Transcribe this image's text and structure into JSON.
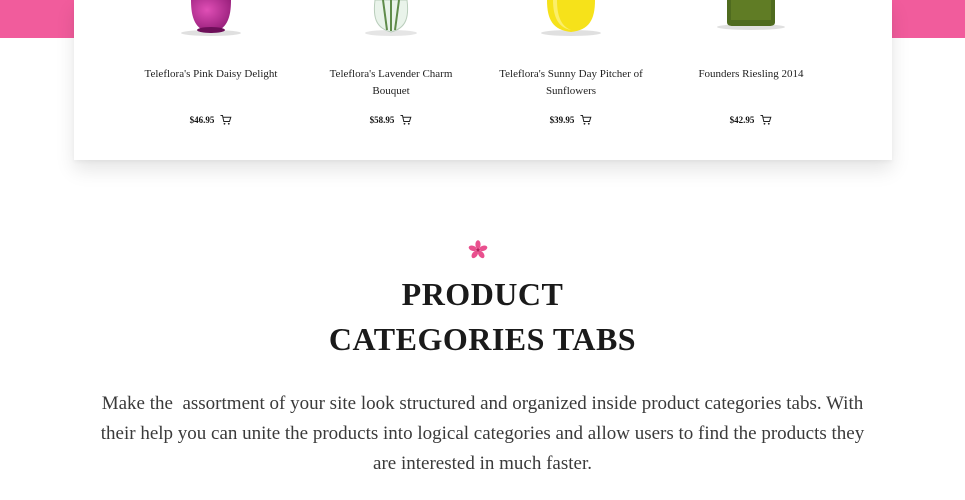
{
  "colors": {
    "accent_pink": "#f15c9c",
    "flower_pink": "#e9508e",
    "text_dark": "#1a1a1a",
    "text_body": "#3a3a3a"
  },
  "products": [
    {
      "name": "Teleflora's Pink Daisy Delight",
      "price": "$46.95",
      "image_icon": "pink-vase-icon"
    },
    {
      "name": "Teleflora's Lavender Charm Bouquet",
      "price": "$58.95",
      "image_icon": "glass-vase-icon"
    },
    {
      "name": "Teleflora's Sunny Day Pitcher of Sunflowers",
      "price": "$39.95",
      "image_icon": "yellow-pitcher-icon"
    },
    {
      "name": "Founders Riesling 2014",
      "price": "$42.95",
      "image_icon": "wine-bottle-icon"
    }
  ],
  "section": {
    "icon": "flower-icon",
    "title_line1": "PRODUCT",
    "title_line2": "CATEGORIES TABS",
    "description": "Make the  assortment of your site look structured and organized inside product categories tabs. With their help you can unite the products into logical categories and allow users to find the products they are interested in much faster."
  }
}
